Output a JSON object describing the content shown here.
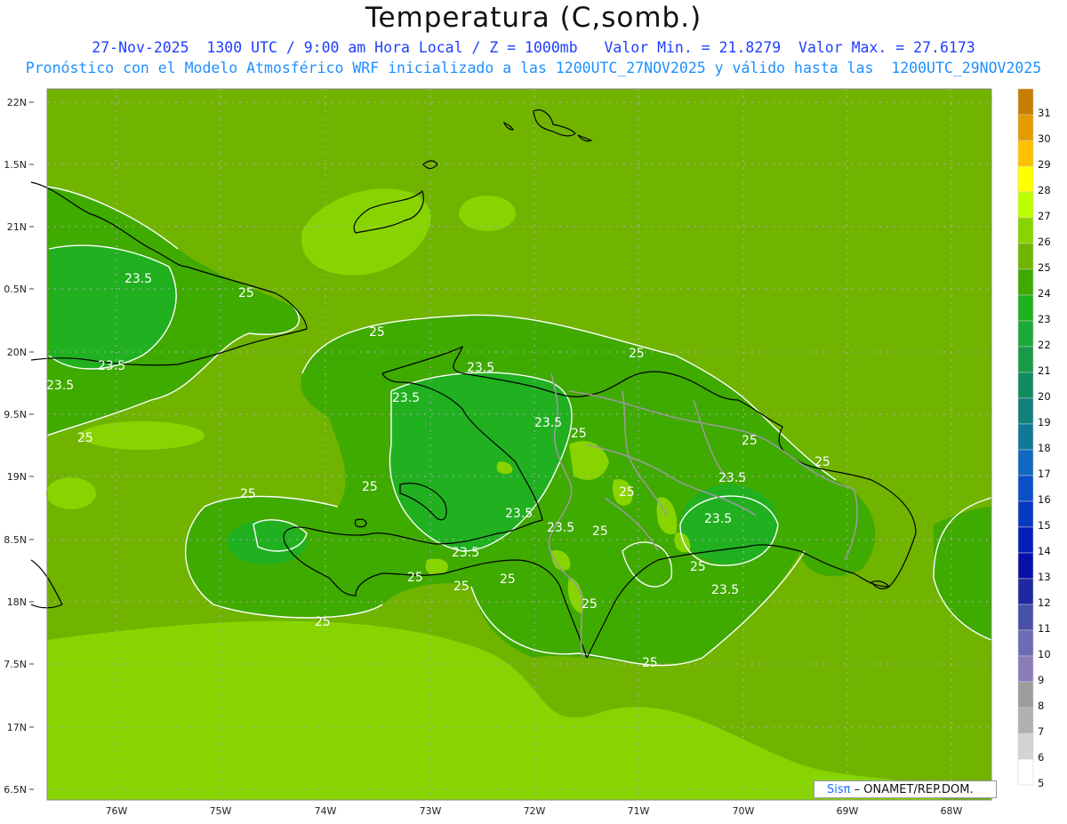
{
  "title": "Temperatura (C,somb.)",
  "subtitle_line1": "27-Nov-2025  1300 UTC / 9:00 am Hora Local / Z = 1000mb   Valor Min. = 21.8279  Valor Max. = 27.6173",
  "subtitle_line2": "Pronóstico con el Modelo Atmosférico WRF inicializado a las 1200UTC_27NOV2025 y válido hasta las  1200UTC_29NOV2025",
  "lat_labels": [
    "22N",
    "1.5N",
    "21N",
    "0.5N",
    "20N",
    "9.5N",
    "19N",
    "8.5N",
    "18N",
    "7.5N",
    "17N",
    "6.5N"
  ],
  "lon_labels": [
    "76W",
    "75W",
    "74W",
    "73W",
    "72W",
    "71W",
    "70W",
    "69W",
    "68W"
  ],
  "contour_labels": [
    {
      "text": "23.5"
    },
    {
      "text": "25"
    },
    {
      "text": "23.5"
    },
    {
      "text": "23.5"
    },
    {
      "text": "25"
    },
    {
      "text": "25"
    },
    {
      "text": "23.5"
    },
    {
      "text": "25"
    },
    {
      "text": "23.5"
    },
    {
      "text": "23.5"
    },
    {
      "text": "25"
    },
    {
      "text": "25"
    },
    {
      "text": "25"
    },
    {
      "text": "25"
    },
    {
      "text": "23.5"
    },
    {
      "text": "25"
    },
    {
      "text": "23.5"
    },
    {
      "text": "23.5"
    },
    {
      "text": "25"
    },
    {
      "text": "23.5"
    },
    {
      "text": "25"
    },
    {
      "text": "25"
    },
    {
      "text": "23.5"
    },
    {
      "text": "25"
    },
    {
      "text": "25"
    },
    {
      "text": "25"
    },
    {
      "text": "25"
    },
    {
      "text": "25"
    },
    {
      "text": "25"
    },
    {
      "text": "23.5"
    }
  ],
  "colorbar": {
    "labels": [
      "31",
      "30",
      "29",
      "28",
      "27",
      "26",
      "25",
      "24",
      "23",
      "22",
      "21",
      "20",
      "19",
      "18",
      "17",
      "16",
      "15",
      "14",
      "13",
      "12",
      "11",
      "10",
      "9",
      "8",
      "7",
      "6",
      "5"
    ],
    "colors": [
      "#c77d00",
      "#e59a00",
      "#ffc000",
      "#ffff00",
      "#bfff00",
      "#88d400",
      "#70b400",
      "#3faa00",
      "#20b020",
      "#1eaa3a",
      "#189a48",
      "#148a60",
      "#14807c",
      "#12789a",
      "#1068c0",
      "#0c50c8",
      "#0838c0",
      "#0420b8",
      "#0810a8",
      "#1e28a0",
      "#4850a8",
      "#6c6cb4",
      "#8c7cb8",
      "#9c9c9c",
      "#b0b0b0",
      "#d4d4d4",
      "#ffffff"
    ]
  },
  "credit": {
    "brand": "Sisπ",
    "text": " – ONAMET/REP.DOM."
  }
}
